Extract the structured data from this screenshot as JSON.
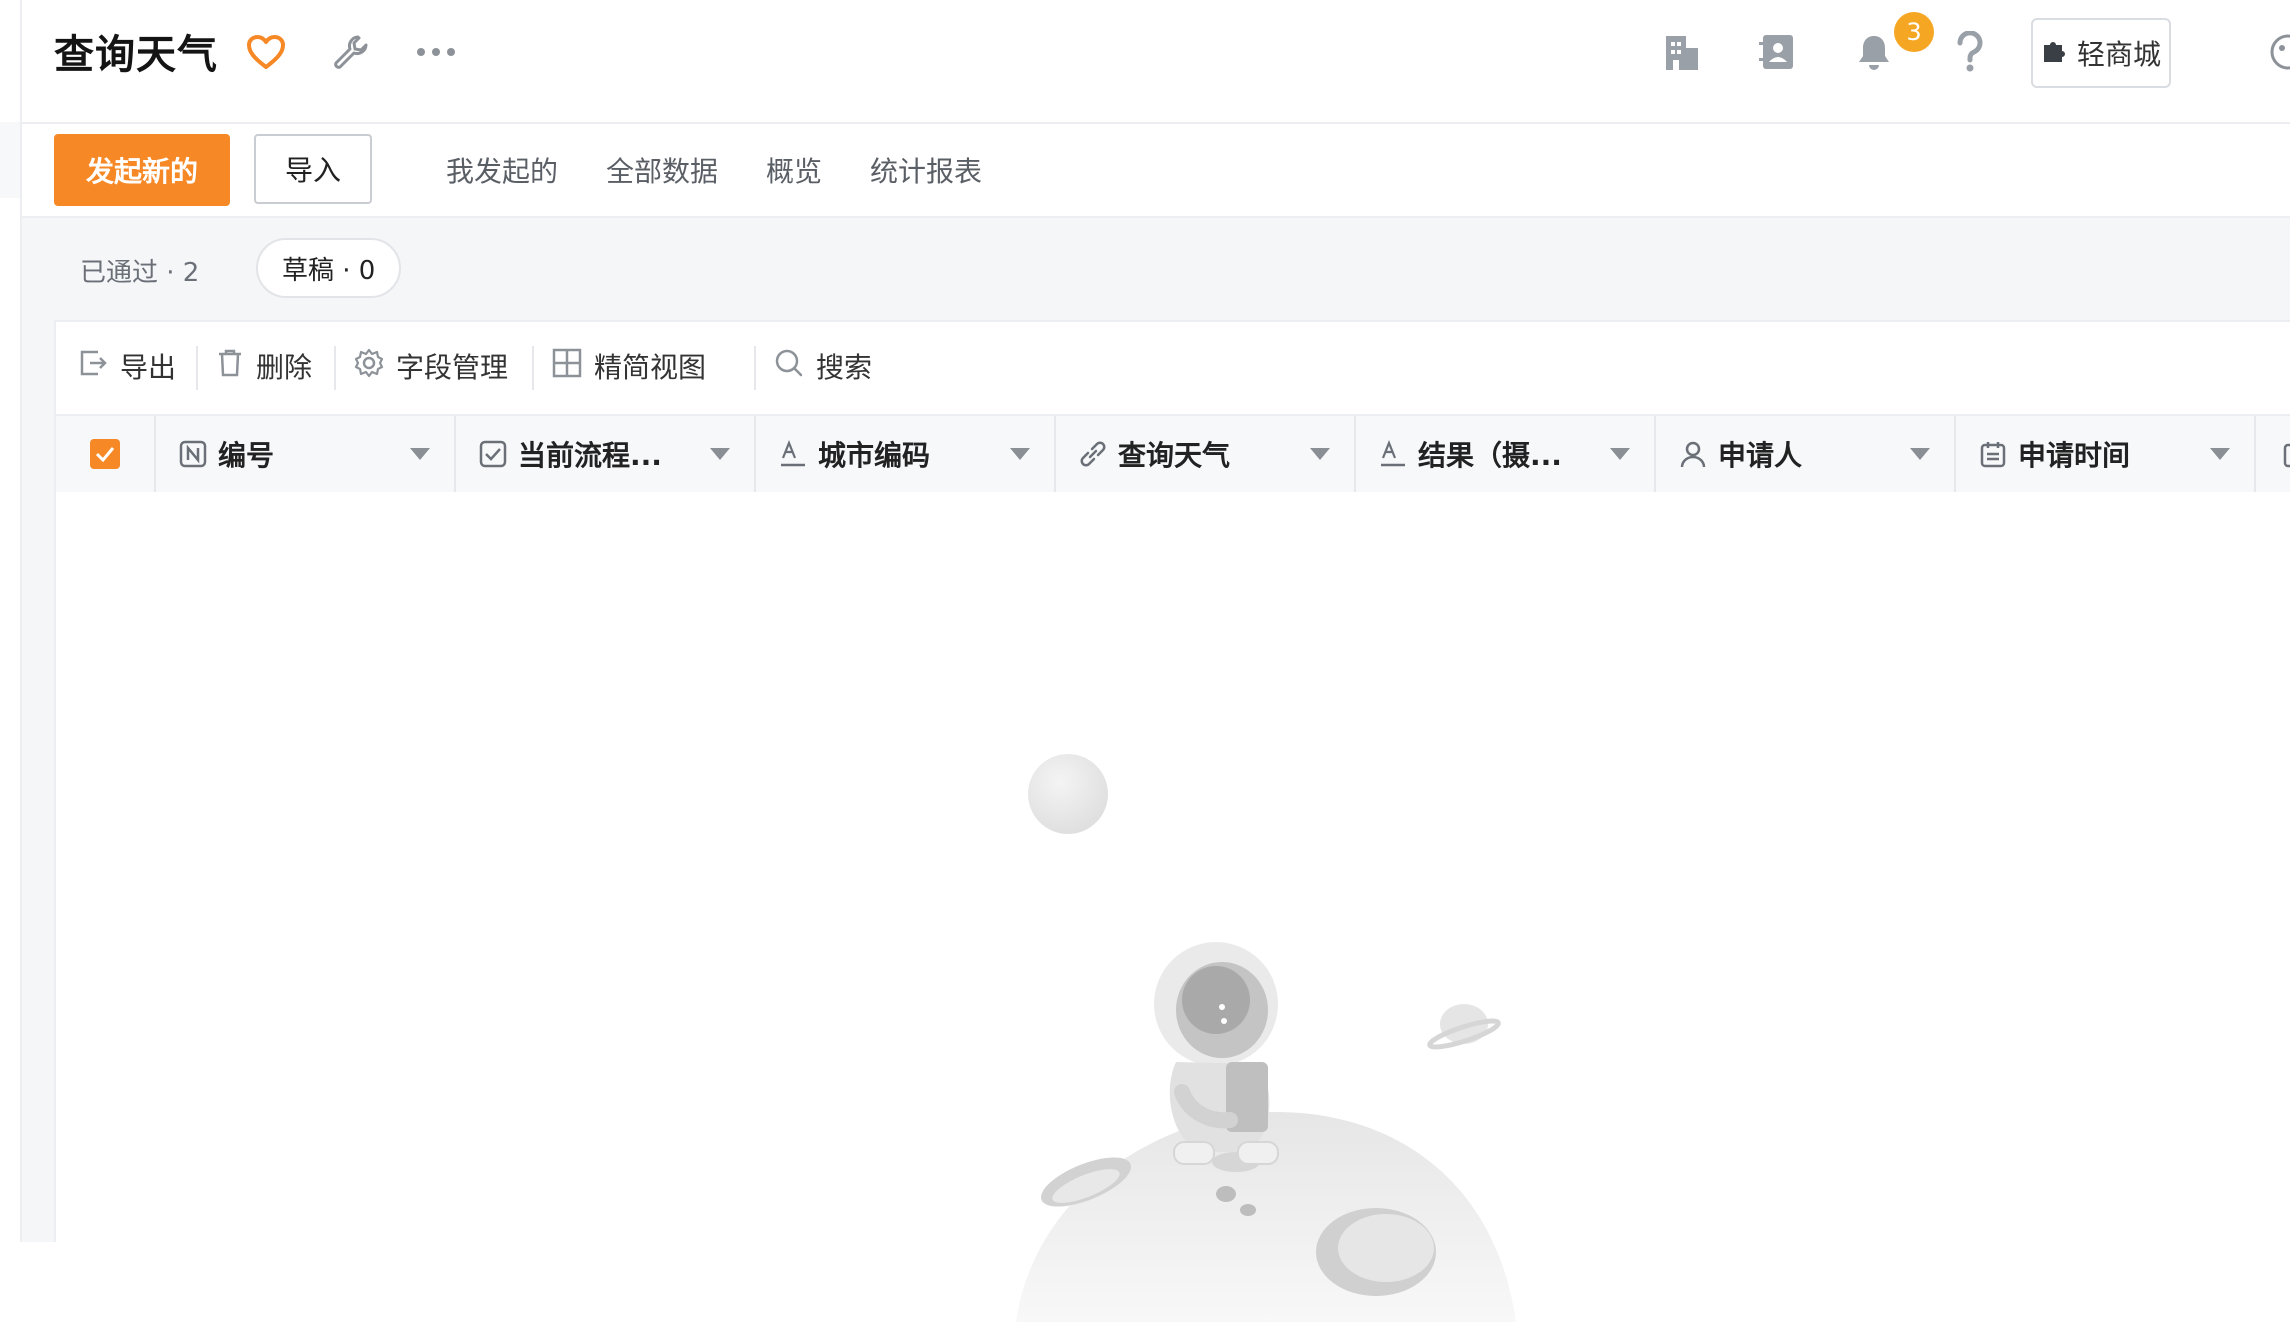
{
  "header": {
    "title": "查询天气",
    "mall_label": "轻商城",
    "notification_count": "3",
    "icons": [
      "heart-icon",
      "wrench-icon",
      "more-icon",
      "building-icon",
      "contacts-icon",
      "bell-icon",
      "help-icon",
      "puzzle-icon",
      "avatar"
    ]
  },
  "actions": {
    "primary_label": "发起新的",
    "import_label": "导入",
    "tabs": [
      "我发起的",
      "全部数据",
      "概览",
      "统计报表"
    ]
  },
  "filters": {
    "passed": "已通过 · 2",
    "draft": "草稿 · 0"
  },
  "toolbar": {
    "export": "导出",
    "delete": "删除",
    "fields": "字段管理",
    "compact": "精简视图",
    "search": "搜索"
  },
  "table": {
    "columns": [
      "编号",
      "当前流程...",
      "城市编码",
      "查询天气",
      "结果（摄...",
      "申请人",
      "申请时间"
    ]
  },
  "colors": {
    "accent": "#f68826",
    "badge": "#f5a623"
  }
}
